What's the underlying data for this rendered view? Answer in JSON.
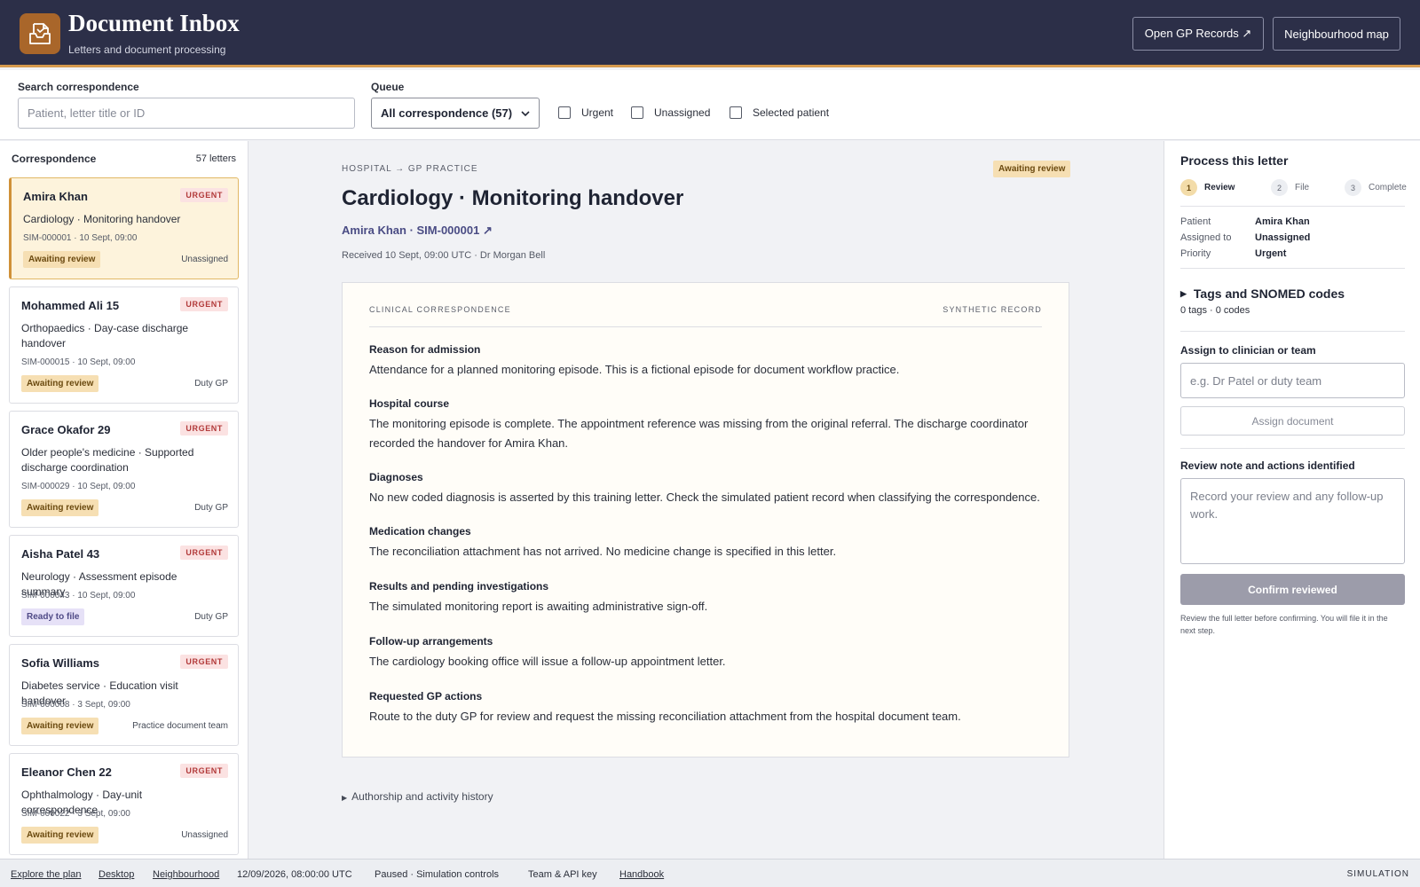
{
  "header": {
    "title": "Document Inbox",
    "subtitle": "Letters and document processing",
    "open_gp_records": "Open GP Records ↗",
    "neighbourhood_map": "Neighbourhood map",
    "colors": {
      "bar": "#2c2f48",
      "accent": "#d69a4e",
      "logo": "#a9662a"
    }
  },
  "filters": {
    "search_label": "Search correspondence",
    "search_placeholder": "Patient, letter title or ID",
    "queue_label": "Queue",
    "queue_selected": "All correspondence (57)",
    "checkboxes": [
      {
        "label": "Urgent",
        "checked": false
      },
      {
        "label": "Unassigned",
        "checked": false
      },
      {
        "label": "Selected patient",
        "checked": false
      }
    ]
  },
  "list": {
    "heading": "Correspondence",
    "count": "57 letters",
    "items": [
      {
        "name": "Amira Khan",
        "urgency": "URGENT",
        "title": "Cardiology · Monitoring handover",
        "meta": "SIM-000001 · 10 Sept, 09:00",
        "status": "Awaiting review",
        "assignee": "Unassigned",
        "selected": true
      },
      {
        "name": "Mohammed Ali 15",
        "urgency": "URGENT",
        "title": "Orthopaedics · Day-case discharge handover",
        "meta": "SIM-000015 · 10 Sept, 09:00",
        "status": "Awaiting review",
        "assignee": "Duty GP"
      },
      {
        "name": "Grace Okafor 29",
        "urgency": "URGENT",
        "title": "Older people's medicine · Supported discharge coordination",
        "meta": "SIM-000029 · 10 Sept, 09:00",
        "status": "Awaiting review",
        "assignee": "Duty GP"
      },
      {
        "name": "Aisha Patel 43",
        "urgency": "URGENT",
        "title": "Neurology · Assessment episode summary",
        "meta": "SIM-000043 · 10 Sept, 09:00",
        "status": "Ready to file",
        "assignee": "Duty GP"
      },
      {
        "name": "Sofia Williams",
        "urgency": "URGENT",
        "title": "Diabetes service · Education visit handover",
        "meta": "SIM-000008 · 3 Sept, 09:00",
        "status": "Awaiting review",
        "assignee": "Practice document team"
      },
      {
        "name": "Eleanor Chen 22",
        "urgency": "URGENT",
        "title": "Ophthalmology · Day-unit correspondence",
        "meta": "SIM-000022 · 3 Sept, 09:00",
        "status": "Awaiting review",
        "assignee": "Unassigned"
      }
    ]
  },
  "document": {
    "route": "HOSPITAL → GP PRACTICE",
    "status": "Awaiting review",
    "title": "Cardiology · Monitoring handover",
    "patient_link": "Amira Khan · SIM-000001 ↗",
    "received": "Received 10 Sept, 09:00 UTC · Dr Morgan Bell",
    "kicker": "CLINICAL CORRESPONDENCE",
    "synthetic": "SYNTHETIC RECORD",
    "sections": [
      {
        "heading": "Reason for admission",
        "body": "Attendance for a planned monitoring episode. This is a fictional episode for document workflow practice."
      },
      {
        "heading": "Hospital course",
        "body": "The monitoring episode is complete. The appointment reference was missing from the original referral. The discharge coordinator recorded the handover for Amira Khan."
      },
      {
        "heading": "Diagnoses",
        "body": "No new coded diagnosis is asserted by this training letter. Check the simulated patient record when classifying the correspondence."
      },
      {
        "heading": "Medication changes",
        "body": "The reconciliation attachment has not arrived. No medicine change is specified in this letter."
      },
      {
        "heading": "Results and pending investigations",
        "body": "The simulated monitoring report is awaiting administrative sign-off."
      },
      {
        "heading": "Follow-up arrangements",
        "body": "The cardiology booking office will issue a follow-up appointment letter."
      },
      {
        "heading": "Requested GP actions",
        "body": "Route to the duty GP for review and request the missing reconciliation attachment from the hospital document team."
      }
    ],
    "history": "Authorship and activity history"
  },
  "process": {
    "title": "Process this letter",
    "steps": [
      {
        "num": "1",
        "label": "Review",
        "active": true
      },
      {
        "num": "2",
        "label": "File",
        "active": false
      },
      {
        "num": "3",
        "label": "Complete",
        "active": false
      }
    ],
    "details": [
      {
        "key": "Patient",
        "value": "Amira Khan"
      },
      {
        "key": "Assigned to",
        "value": "Unassigned"
      },
      {
        "key": "Priority",
        "value": "Urgent"
      }
    ],
    "tags_heading": "Tags and SNOMED codes",
    "tags_count": "0 tags · 0 codes",
    "assign_label": "Assign to clinician or team",
    "assign_placeholder": "e.g. Dr Patel or duty team",
    "assign_button": "Assign document",
    "note_label": "Review note and actions identified",
    "note_placeholder": "Record your review and any follow-up work.",
    "confirm_button": "Confirm reviewed",
    "helper": "Review the full letter before confirming. You will file it in the next step."
  },
  "footer": {
    "explore": "Explore the plan",
    "desktop": "Desktop",
    "neighbourhood": "Neighbourhood",
    "clock": "12/09/2026, 08:00:00 UTC",
    "sim_controls": "Paused · Simulation controls",
    "team": "Team & API key",
    "handbook": "Handbook",
    "mode": "SIMULATION"
  }
}
